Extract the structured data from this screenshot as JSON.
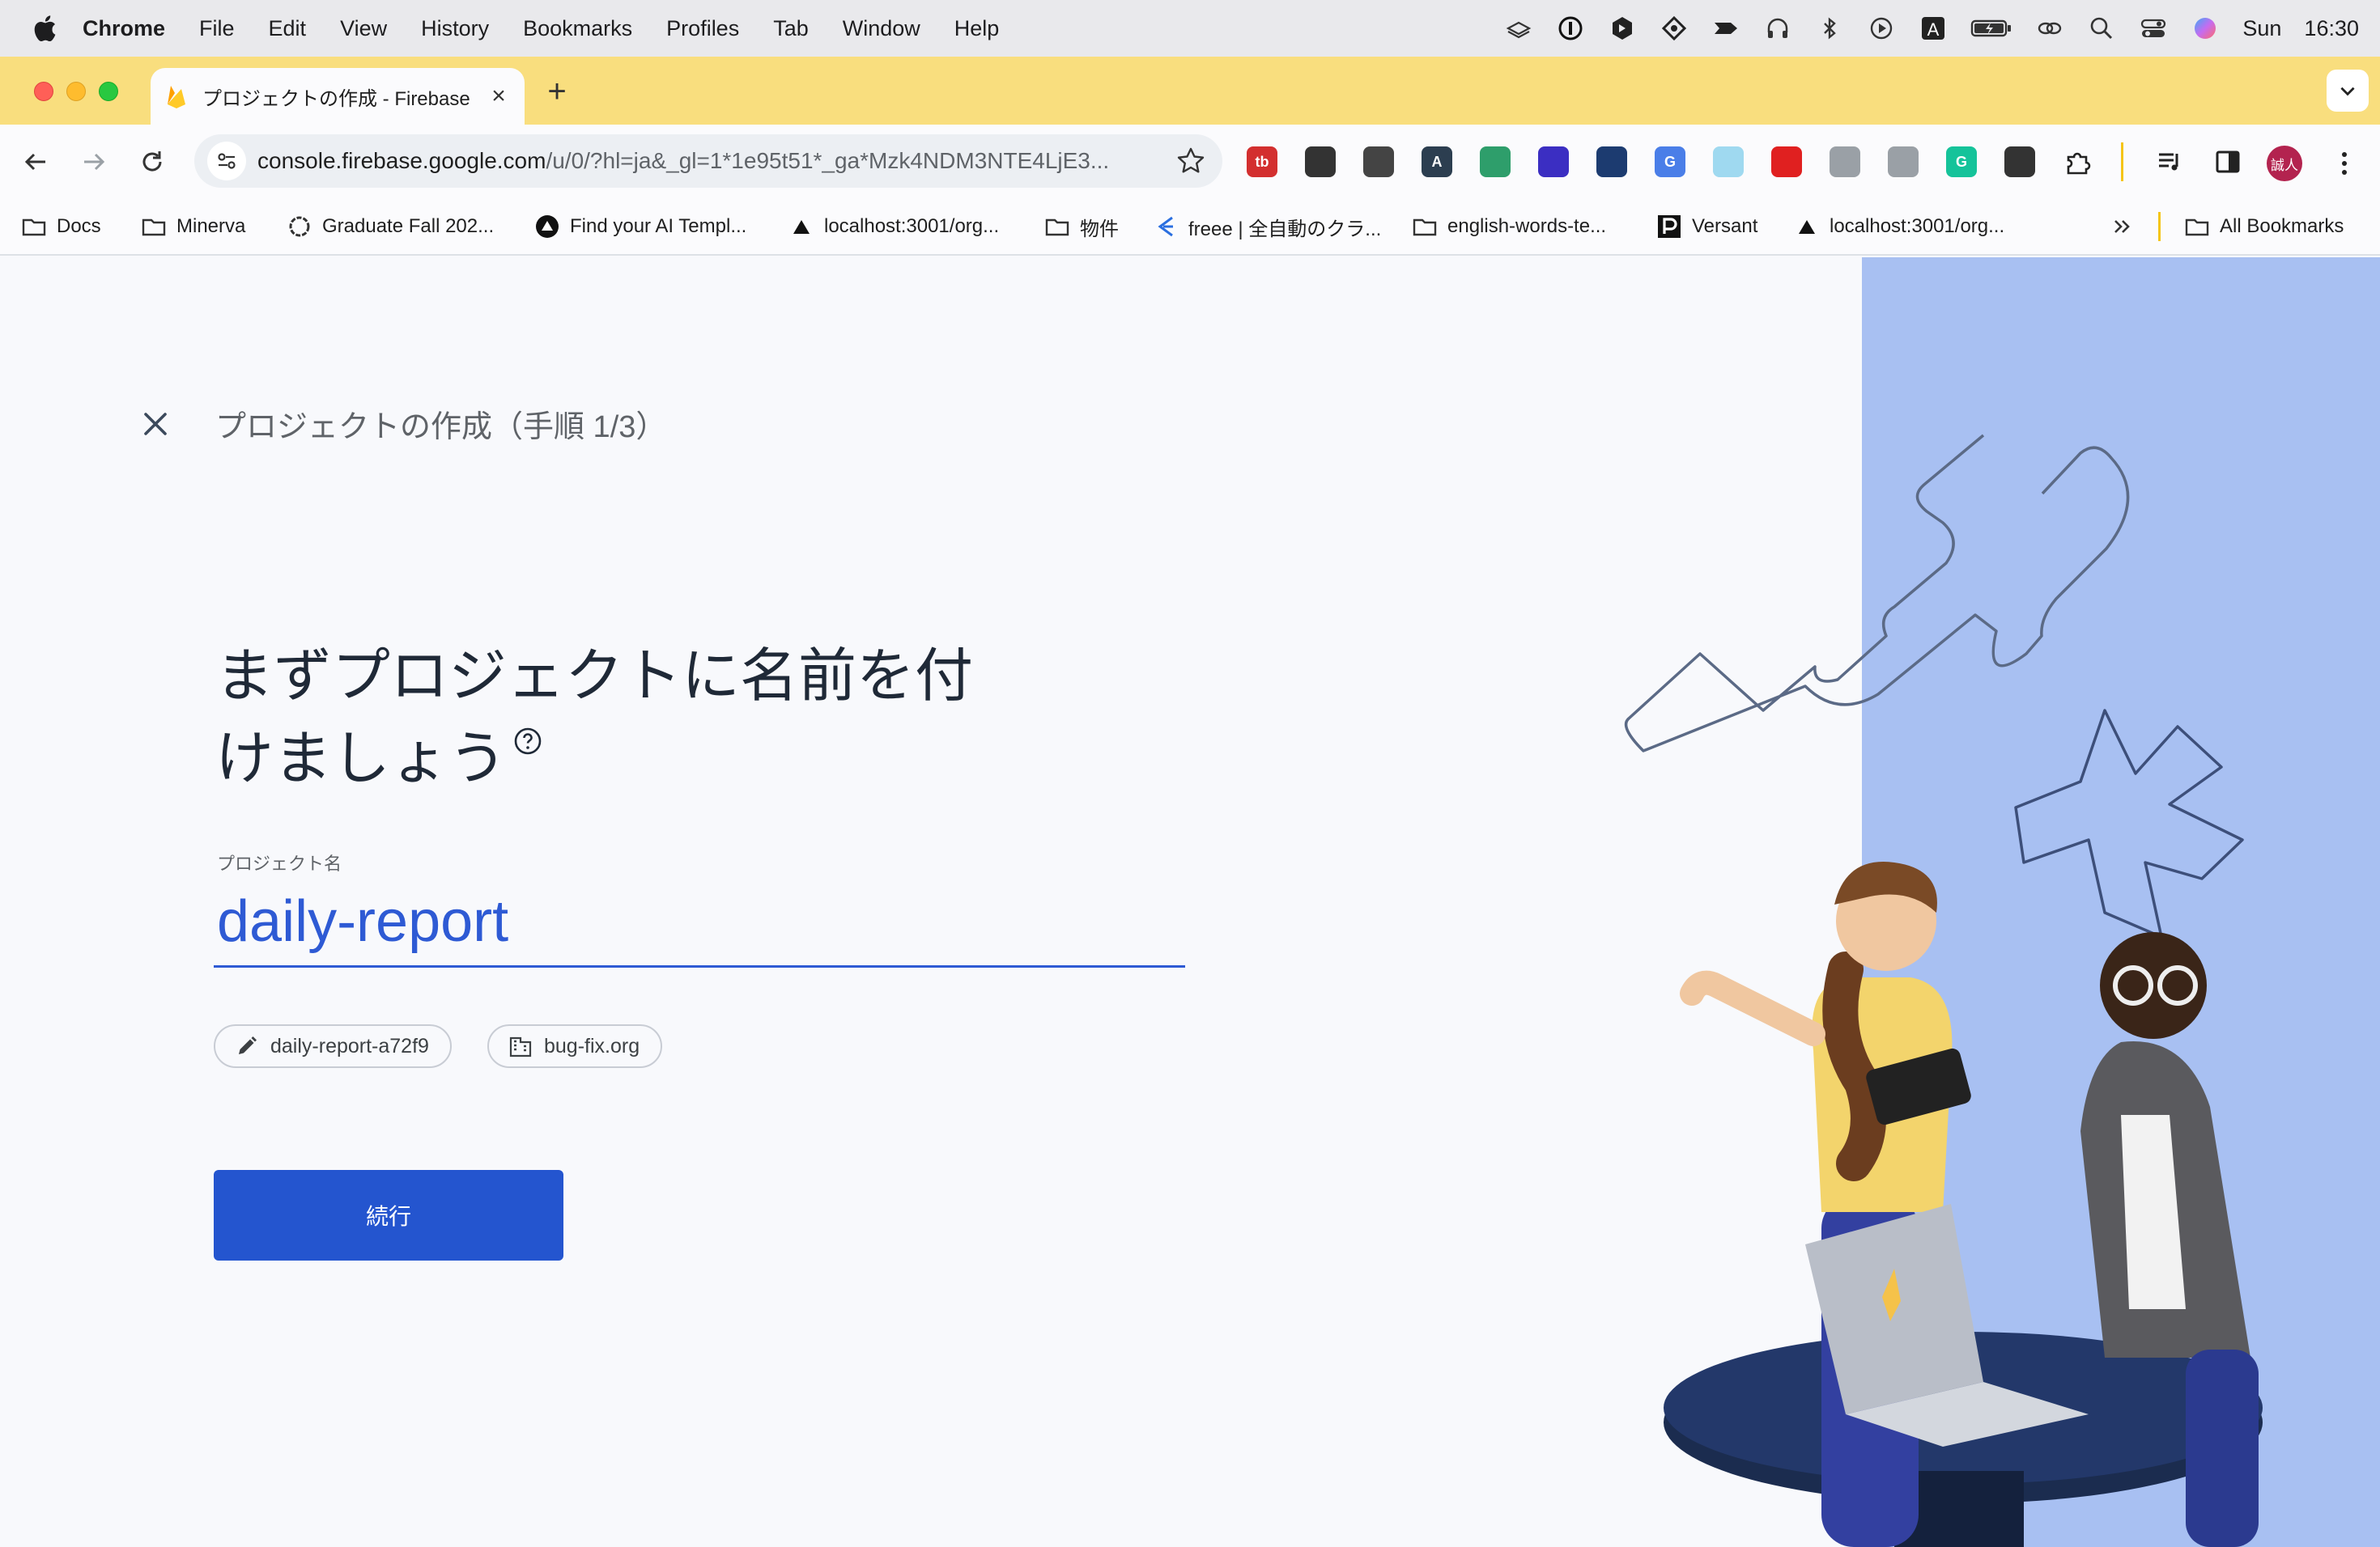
{
  "menubar": {
    "app": "Chrome",
    "items": [
      "File",
      "Edit",
      "View",
      "History",
      "Bookmarks",
      "Profiles",
      "Tab",
      "Window",
      "Help"
    ],
    "day": "Sun",
    "time": "16:30"
  },
  "tab": {
    "title": "プロジェクトの作成 - Firebase"
  },
  "toolbar": {
    "url_host": "console.firebase.google.com",
    "url_path": "/u/0/?hl=ja&_gl=1*1e95t51*_ga*Mzk4NDM3NTE4LjE3...",
    "profile_initials": "誠人"
  },
  "extensions": [
    {
      "name": "tb-extension-icon",
      "label": "tb",
      "color": "#d32f2f"
    },
    {
      "name": "qr-code-icon",
      "label": "",
      "color": "#333333"
    },
    {
      "name": "circle-extension-icon",
      "label": "",
      "color": "#444444"
    },
    {
      "name": "a-extension-icon",
      "label": "A",
      "color": "#2c3e50"
    },
    {
      "name": "quote-extension-icon",
      "label": "",
      "color": "#2e9e6b"
    },
    {
      "name": "layers-extension-icon",
      "label": "",
      "color": "#3b2ec2"
    },
    {
      "name": "hex-extension-icon",
      "label": "",
      "color": "#1c3b70"
    },
    {
      "name": "google-translate-icon",
      "label": "G",
      "color": "#4a7ee8"
    },
    {
      "name": "square-extension-icon",
      "label": "",
      "color": "#9fd9f0"
    },
    {
      "name": "youtube-extension-icon",
      "label": "",
      "color": "#e02020"
    },
    {
      "name": "camera-extension-icon",
      "label": "",
      "color": "#9aa0a6"
    },
    {
      "name": "robot-extension-icon",
      "label": "",
      "color": "#9aa0a6"
    },
    {
      "name": "grammarly-icon",
      "label": "G",
      "color": "#15c39a"
    },
    {
      "name": "swirl-extension-icon",
      "label": "",
      "color": "#333333"
    }
  ],
  "bookmarks": [
    {
      "name": "bookmark-docs",
      "icon": "folder-icon",
      "label": "Docs"
    },
    {
      "name": "bookmark-minerva",
      "icon": "folder-icon",
      "label": "Minerva"
    },
    {
      "name": "bookmark-graduate-fall",
      "icon": "circle-icon",
      "label": "Graduate Fall 202..."
    },
    {
      "name": "bookmark-find-ai-template",
      "icon": "vercel-icon",
      "label": "Find your AI Templ..."
    },
    {
      "name": "bookmark-localhost-1",
      "icon": "triangle-icon",
      "label": "localhost:3001/org..."
    },
    {
      "name": "bookmark-bukken",
      "icon": "folder-icon",
      "label": "物件"
    },
    {
      "name": "bookmark-freee",
      "icon": "freee-icon",
      "label": "freee | 全自動のクラ..."
    },
    {
      "name": "bookmark-english-words",
      "icon": "folder-icon",
      "label": "english-words-te..."
    },
    {
      "name": "bookmark-versant",
      "icon": "versant-icon",
      "label": "Versant"
    },
    {
      "name": "bookmark-localhost-2",
      "icon": "triangle-icon",
      "label": "localhost:3001/org..."
    },
    {
      "name": "bookmark-all",
      "icon": "folder-icon",
      "label": "All Bookmarks"
    }
  ],
  "page": {
    "step_title": "プロジェクトの作成（手順 1/3）",
    "heading_line1": "まずプロジェクトに名前を付",
    "heading_line2": "けましょう",
    "field_label": "プロジェクト名",
    "project_name": "daily-report",
    "project_id": "daily-report-a72f9",
    "organization": "bug-fix.org",
    "continue_label": "続行"
  },
  "colors": {
    "accent": "#2455cf",
    "panel": "#a8c0f2",
    "tab_strip": "#f9de7e"
  }
}
